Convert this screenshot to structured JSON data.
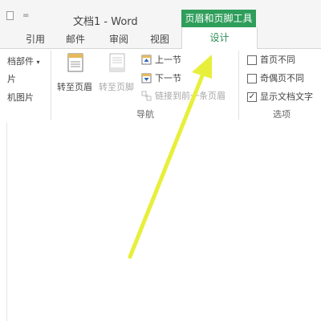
{
  "window": {
    "title": "文档1 - Word",
    "quick_access_separator": "="
  },
  "context_tab_header": "页眉和页脚工具",
  "tabs": {
    "references": "引用",
    "mailings": "邮件",
    "review": "审阅",
    "view": "视图",
    "design": "设计"
  },
  "insert_group": {
    "doc_parts": "档部件",
    "doc_parts_arrow": "▾",
    "pictures": "片",
    "online_pictures": "机图片"
  },
  "navigation": {
    "goto_header": "转至页眉",
    "goto_footer": "转至页脚",
    "previous_section": "上一节",
    "next_section": "下一节",
    "link_to_previous": "链接到前一条页眉",
    "group_label": "导航"
  },
  "options": {
    "different_first_page": "首页不同",
    "different_odd_even": "奇偶页不同",
    "show_document_text": "显示文档文字",
    "show_document_text_checked": "✓",
    "group_label": "选项"
  },
  "colors": {
    "accent_green": "#2f9e5b",
    "arrow_yellow": "#e8ef3a"
  }
}
